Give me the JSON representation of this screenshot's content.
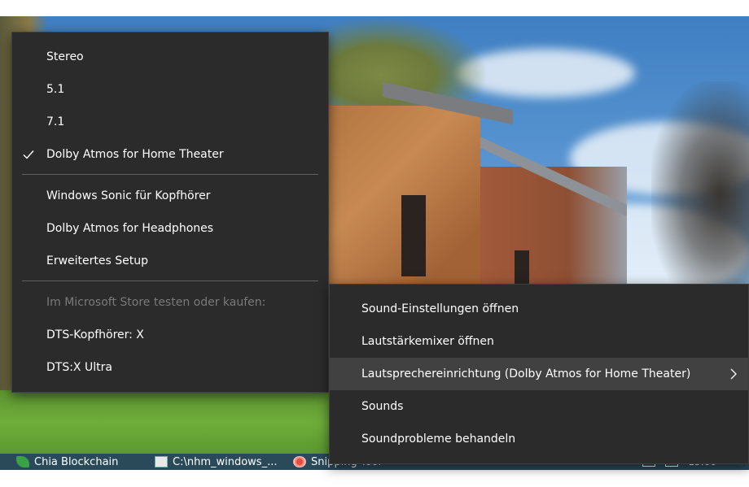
{
  "audio_menu": {
    "items": [
      {
        "label": "Stereo",
        "checked": false
      },
      {
        "label": "5.1",
        "checked": false
      },
      {
        "label": "7.1",
        "checked": false
      },
      {
        "label": "Dolby Atmos for Home Theater",
        "checked": true
      },
      {
        "label": "Windows Sonic für Kopfhörer",
        "checked": false
      },
      {
        "label": "Dolby Atmos for Headphones",
        "checked": false
      },
      {
        "label": "Erweitertes Setup",
        "checked": false
      }
    ],
    "store_header": "Im Microsoft Store testen oder kaufen:",
    "store_items": [
      "DTS-Kopfhörer: X",
      "DTS:X Ultra"
    ]
  },
  "context_menu": {
    "items": [
      {
        "label": "Sound-Einstellungen öffnen"
      },
      {
        "label": "Lautstärkemixer öffnen"
      },
      {
        "label": "Lautsprechereinrichtung (Dolby Atmos for Home Theater)",
        "submenu": true,
        "highlighted": true
      },
      {
        "label": "Sounds"
      },
      {
        "label": "Soundprobleme behandeln"
      }
    ]
  },
  "taskbar": {
    "apps": [
      {
        "label": "Chia Blockchain",
        "icon": "chia-leaf-icon"
      },
      {
        "label": "C:\\nhm_windows_...",
        "icon": "folder-window-icon"
      },
      {
        "label": "Snipping Tool",
        "icon": "snipping-tool-icon"
      }
    ],
    "clock": "15:00"
  },
  "colors": {
    "menu_bg": "#2b2b2b",
    "menu_highlight": "#414141",
    "separator": "#5f5f5f",
    "disabled_text": "#7a7a7a"
  }
}
